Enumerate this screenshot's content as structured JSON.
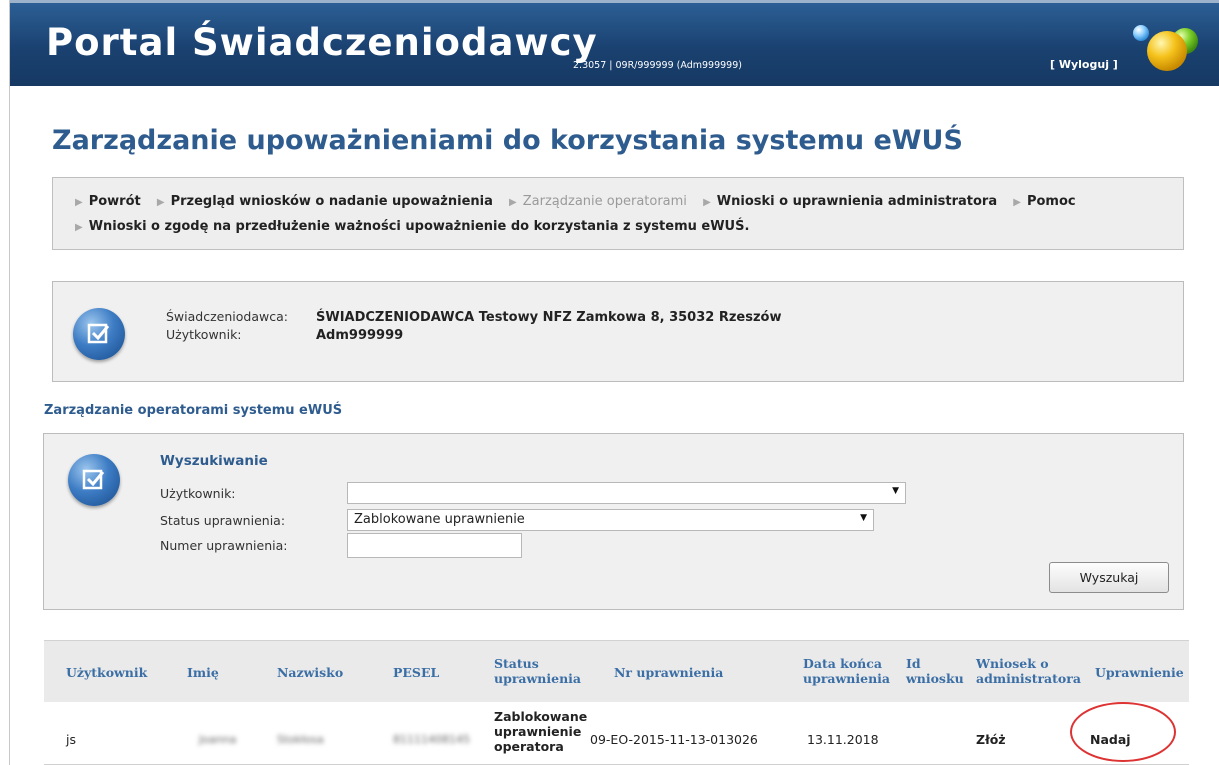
{
  "header": {
    "app_title": "Portal Świadczeniodawcy",
    "version_info": "2.3057 | 09R/999999 (Adm999999)",
    "logout_label": "[ Wyloguj ]"
  },
  "page_title": "Zarządzanie upoważnieniami do korzystania systemu eWUŚ",
  "nav": {
    "items": [
      {
        "label": "Powrót",
        "enabled": true
      },
      {
        "label": "Przegląd wniosków o nadanie upoważnienia",
        "enabled": true
      },
      {
        "label": "Zarządzanie operatorami",
        "enabled": false
      },
      {
        "label": "Wnioski o uprawnienia administratora",
        "enabled": true
      },
      {
        "label": "Pomoc",
        "enabled": true
      },
      {
        "label": "Wnioski o zgodę na przedłużenie ważności upoważnienie do korzystania z systemu eWUŚ.",
        "enabled": true
      }
    ]
  },
  "provider_info": {
    "provider_label": "Świadczeniodawca:",
    "provider_value": "ŚWIADCZENIODAWCA Testowy NFZ Zamkowa 8, 35032 Rzeszów",
    "user_label": "Użytkownik:",
    "user_value": "Adm999999"
  },
  "section_title": "Zarządzanie operatorami systemu eWUŚ",
  "search": {
    "heading": "Wyszukiwanie",
    "user_label": "Użytkownik:",
    "user_value": "",
    "status_label": "Status uprawnienia:",
    "status_value": "Zablokowane uprawnienie",
    "number_label": "Numer uprawnienia:",
    "number_value": "",
    "search_button": "Wyszukaj"
  },
  "table": {
    "headers": {
      "user": "Użytkownik",
      "first_name": "Imię",
      "last_name": "Nazwisko",
      "pesel": "PESEL",
      "status_line1": "Status",
      "status_line2": "uprawnienia",
      "number": "Nr uprawnienia",
      "end_date_line1": "Data końca",
      "end_date_line2": "uprawnienia",
      "id_line1": "Id",
      "id_line2": "wniosku",
      "admin_line1": "Wniosek o",
      "admin_line2": "administratora",
      "permission": "Uprawnienie"
    },
    "rows": [
      {
        "user": "js",
        "first_name": "Joanna",
        "last_name": "Stokłosa",
        "pesel": "81111408145",
        "status_line1": "Zablokowane",
        "status_line2": "uprawnienie",
        "status_line3": "operatora",
        "number": "09-EO-2015-11-13-013026",
        "end_date": "13.11.2018",
        "request_id": "",
        "admin_action": "Złóż",
        "permission_action": "Nadaj"
      }
    ]
  },
  "colors": {
    "header_bg": "#1f4a7d",
    "title_blue": "#2f5c8f",
    "annotation_red": "#dd3333"
  }
}
